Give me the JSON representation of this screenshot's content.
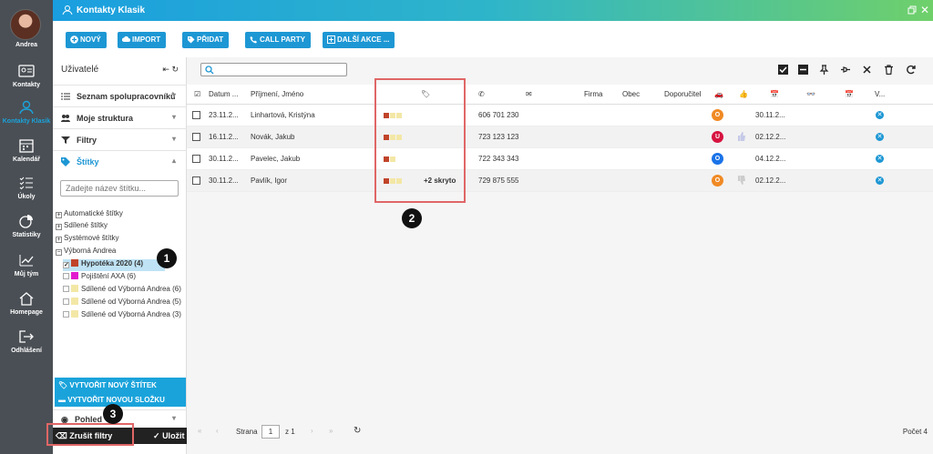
{
  "window": {
    "title": "Kontakty Klasik"
  },
  "nav": {
    "user": "Andrea",
    "items": [
      {
        "label": "Kontakty",
        "icon": "contact-card-icon"
      },
      {
        "label": "Kontakty Klasik",
        "icon": "person-icon",
        "active": true
      },
      {
        "label": "Kalendář",
        "icon": "calendar-icon"
      },
      {
        "label": "Úkoly",
        "icon": "checklist-icon"
      },
      {
        "label": "Statistiky",
        "icon": "pie-chart-icon"
      },
      {
        "label": "Můj tým",
        "icon": "trend-icon"
      },
      {
        "label": "Homepage",
        "icon": "home-icon"
      },
      {
        "label": "Odhlášení",
        "icon": "logout-icon"
      }
    ]
  },
  "toolbar": {
    "new": "NOVÝ",
    "import": "IMPORT",
    "add": "PŘIDAT",
    "call_party": "CALL PARTY",
    "more": "DALŠÍ AKCE ..."
  },
  "left_panel": {
    "title": "Uživatelé",
    "sections": [
      {
        "label": "Seznam spolupracovníků",
        "icon": "list-icon"
      },
      {
        "label": "Moje struktura",
        "icon": "people-icon"
      },
      {
        "label": "Filtry",
        "icon": "filter-icon"
      },
      {
        "label": "Štítky",
        "icon": "tag-icon",
        "active": true
      }
    ],
    "tag_search_placeholder": "Zadejte název štítku...",
    "tree": [
      "Automatické štítky",
      "Sdílené štítky",
      "Systémové štítky",
      "Výborná Andrea"
    ],
    "tags": [
      {
        "label": "Hypotéka 2020 (4)",
        "color": "#c0442a",
        "checked": true
      },
      {
        "label": "Pojištění AXA (6)",
        "color": "#e21bcf",
        "checked": false
      },
      {
        "label": "Sdílené od Výborná Andrea (6)",
        "color": "#f3e7a6",
        "checked": false
      },
      {
        "label": "Sdílené od Výborná Andrea (5)",
        "color": "#f3e7a6",
        "checked": false
      },
      {
        "label": "Sdílené od Výborná Andrea (3)",
        "color": "#f3e7a6",
        "checked": false
      }
    ],
    "create_tag": "VYTVOŘIT NOVÝ ŠTÍTEK",
    "create_folder": "VYTVOŘIT NOVOU SLOŽKU",
    "view": "Pohled",
    "clear_filters": "Zrušit filtry",
    "save": "Uložit"
  },
  "table": {
    "headers": {
      "date": "Datum ...",
      "name": "Příjmení, Jméno",
      "company": "Firma",
      "city": "Obec",
      "referrer": "Doporučitel",
      "v": "V..."
    },
    "rows": [
      {
        "date": "23.11.2...",
        "name": "Linhartová, Kristýna",
        "phone": "606 701 230",
        "status": "O",
        "status_color": "#f08a24",
        "d1": "30.11.2...",
        "d2": "",
        "hidden": ""
      },
      {
        "date": "16.11.2...",
        "name": "Novák, Jakub",
        "phone": "723 123 123",
        "status": "U",
        "status_color": "#d6143f",
        "d1": "02.12.2...",
        "d2": "",
        "hidden": ""
      },
      {
        "date": "30.11.2...",
        "name": "Pavelec, Jakub",
        "phone": "722 343 343",
        "status": "O",
        "status_color": "#1a73e8",
        "d1": "04.12.2...",
        "d2": "",
        "hidden": ""
      },
      {
        "date": "30.11.2...",
        "name": "Pavlík, Igor",
        "phone": "729 875 555",
        "status": "O",
        "status_color": "#f08a24",
        "d1": "02.12.2...",
        "d2": "",
        "hidden": "+2 skryto"
      }
    ]
  },
  "footer": {
    "page_label": "Strana",
    "page_value": "1",
    "of": "z 1",
    "count": "Počet 4"
  },
  "annotations": [
    "1",
    "2",
    "3"
  ]
}
